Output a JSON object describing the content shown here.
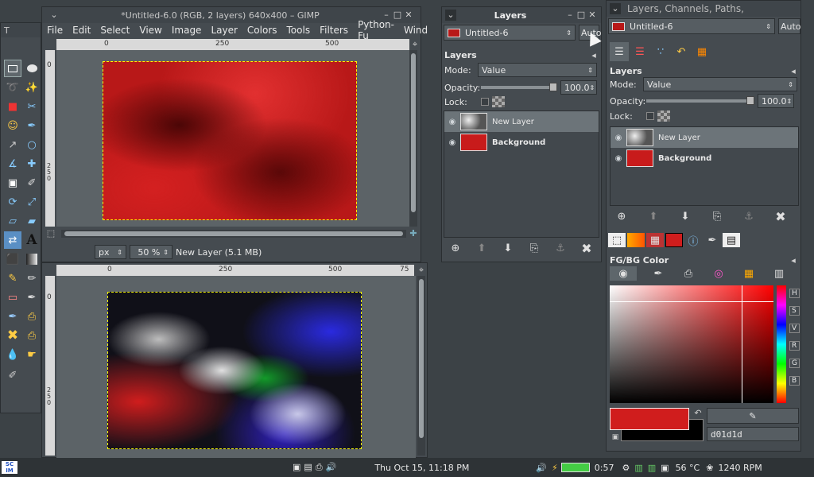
{
  "gimp_window": {
    "title": "*Untitled-6.0 (RGB, 2 layers) 640x400 – GIMP",
    "menu": [
      "File",
      "Edit",
      "Select",
      "View",
      "Image",
      "Layer",
      "Colors",
      "Tools",
      "Filters",
      "Python-Fu",
      "Wind"
    ],
    "ruler_top_ticks": [
      "0",
      "250",
      "500"
    ],
    "ruler_left_ticks": [
      "0",
      "2 5 0"
    ],
    "status": {
      "unit": "px",
      "zoom": "50 %",
      "layer_info": "New Layer (5.1 MB)"
    }
  },
  "second_view": {
    "ruler_top_ticks": [
      "0",
      "250",
      "500",
      "75"
    ],
    "ruler_left_ticks": [
      "0",
      "2 5 0"
    ]
  },
  "toolbox": {
    "title": "T"
  },
  "layers_dialog": {
    "title": "Layers",
    "image_select": "Untitled-6",
    "auto_label": "Auto",
    "section_label": "Layers",
    "mode_label": "Mode:",
    "mode_value": "Value",
    "opacity_label": "Opacity:",
    "opacity_value": "100.0",
    "lock_label": "Lock:",
    "layers": [
      {
        "name": "New Layer"
      },
      {
        "name": "Background"
      }
    ]
  },
  "dock": {
    "title": "Layers, Channels, Paths,",
    "image_select": "Untitled-6",
    "auto_label": "Auto",
    "section_label": "Layers",
    "mode_label": "Mode:",
    "mode_value": "Value",
    "opacity_label": "Opacity:",
    "opacity_value": "100.0",
    "lock_label": "Lock:",
    "layers": [
      {
        "name": "New Layer"
      },
      {
        "name": "Background"
      }
    ],
    "fgbg_title": "FG/BG Color",
    "channel_letters": [
      "H",
      "S",
      "V",
      "R",
      "G",
      "B"
    ],
    "hex_value": "d01d1d",
    "fg_color": "#d01d1d"
  },
  "taskbar": {
    "logo": "SC IM",
    "clock": "Thu Oct 15, 11:18 PM",
    "battery": "0:57",
    "temperature": "56 °C",
    "fan": "1240 RPM"
  }
}
